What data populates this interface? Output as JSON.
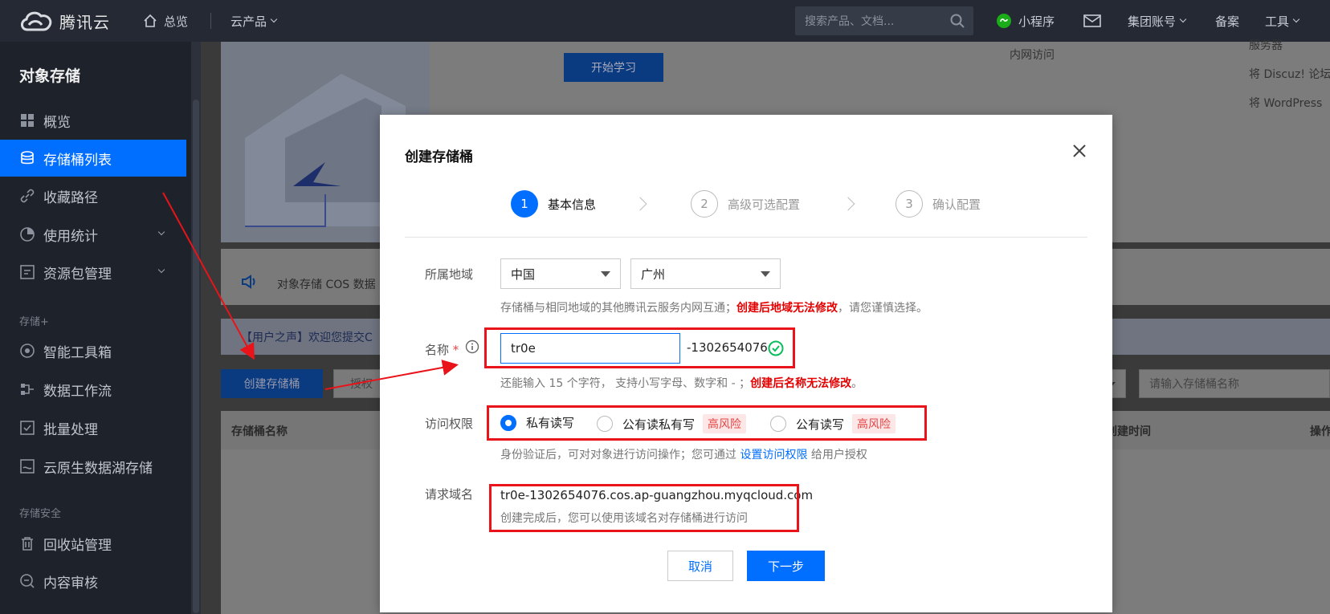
{
  "brand": {
    "logo_text": "腾讯云"
  },
  "topbar": {
    "overview": "总览",
    "cloud_products": "云产品",
    "search_placeholder": "搜索产品、文档...",
    "mini_program": "小程序",
    "group_account": "集团账号",
    "filing": "备案",
    "tools": "工具"
  },
  "sidebar": {
    "title": "对象存储",
    "items": [
      {
        "label": "概览",
        "icon": "grid-icon"
      },
      {
        "label": "存储桶列表",
        "icon": "database-icon",
        "active": true
      },
      {
        "label": "收藏路径",
        "icon": "link-icon"
      },
      {
        "label": "使用统计",
        "icon": "pie-chart-icon",
        "expandable": true
      },
      {
        "label": "资源包管理",
        "icon": "package-icon",
        "expandable": true
      }
    ],
    "group1": "存储+",
    "items2": [
      {
        "label": "智能工具箱",
        "icon": "toolbox-icon"
      },
      {
        "label": "数据工作流",
        "icon": "workflow-icon"
      },
      {
        "label": "批量处理",
        "icon": "checklist-icon"
      },
      {
        "label": "云原生数据湖存储",
        "icon": "lake-icon"
      }
    ],
    "group2": "存储安全",
    "items3": [
      {
        "label": "回收站管理",
        "icon": "trash-icon"
      },
      {
        "label": "内容审核",
        "icon": "audit-icon"
      }
    ]
  },
  "background": {
    "start_learning": "开始学习",
    "intranet_access": "内网访问",
    "service_text": "服务器",
    "discuz": "将 Discuz! 论坛",
    "wordpress": "将 WordPress",
    "notice": "对象存储 COS 数据",
    "user_voice": "【用户之声】欢迎您提交C",
    "create_bucket_btn": "创建存储桶",
    "auth_text": "授权",
    "bucket_name_col": "存储桶名称",
    "create_time_col": "创建时间",
    "ops_col": "操作",
    "bucket_search_placeholder": "请输入存储桶名称"
  },
  "dialog": {
    "title": "创建存储桶",
    "steps": [
      {
        "num": "1",
        "label": "基本信息",
        "active": true
      },
      {
        "num": "2",
        "label": "高级可选配置",
        "active": false
      },
      {
        "num": "3",
        "label": "确认配置",
        "active": false
      }
    ],
    "region": {
      "label": "所属地域",
      "country": "中国",
      "city": "广州",
      "hint_pre": "存储桶与相同地域的其他腾讯云服务内网互通；",
      "hint_warn": "创建后地域无法修改",
      "hint_post": "，请您谨慎选择。"
    },
    "name": {
      "label": "名称",
      "required": "*",
      "value": "tr0e",
      "suffix": "-1302654076",
      "hint_pre": "还能输入 15 个字符， 支持小写字母、数字和 - ；",
      "hint_warn": "创建后名称无法修改",
      "hint_post": "。"
    },
    "access": {
      "label": "访问权限",
      "options": [
        {
          "label": "私有读写",
          "selected": true,
          "risk": ""
        },
        {
          "label": "公有读私有写",
          "selected": false,
          "risk": "高风险"
        },
        {
          "label": "公有读写",
          "selected": false,
          "risk": "高风险"
        }
      ],
      "hint_pre": "身份验证后，可对对象进行访问操作；您可通过 ",
      "hint_link": "设置访问权限",
      "hint_post": " 给用户授权"
    },
    "domain": {
      "label": "请求域名",
      "value": "tr0e-1302654076.cos.ap-guangzhou.myqcloud.com",
      "hint": "创建完成后，您可以使用该域名对存储桶进行访问"
    },
    "cancel": "取消",
    "next": "下一步"
  },
  "colors": {
    "primary": "#006eff",
    "highlight": "#e8141a",
    "nav_bg": "#242933",
    "sidebar_bg": "#1e222a"
  }
}
